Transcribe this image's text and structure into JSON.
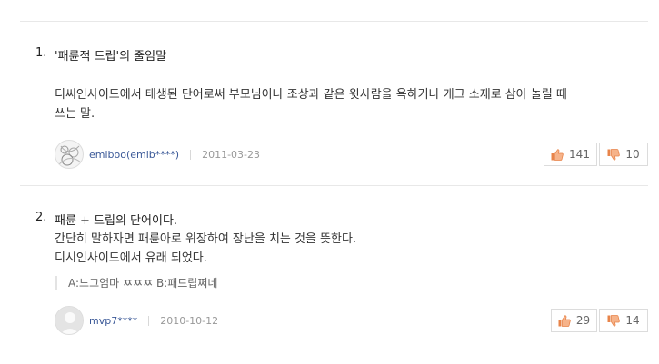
{
  "entries": [
    {
      "number": "1.",
      "title": "'패륜적 드립'의 줄임말",
      "body_lines": [
        "디씨인사이드에서 태생된 단어로써 부모님이나 조상과 같은 윗사람을 욕하거나 개그 소재로 삼아 놀릴 때",
        "쓰는 말."
      ],
      "author": "emiboo(emib****)",
      "date": "2011-03-23",
      "likes": "141",
      "dislikes": "10"
    },
    {
      "number": "2.",
      "title": "패륜 + 드립의 단어이다.",
      "body_lines": [
        "간단히 말하자면 패륜아로 위장하여 장난을 치는 것을 뜻한다.",
        "디시인사이드에서 유래 되었다."
      ],
      "quote": "A:느그엄마 ㅉㅉㅉ B:패드립쩌네",
      "author": "mvp7****",
      "date": "2010-10-12",
      "likes": "29",
      "dislikes": "14"
    }
  ],
  "colors": {
    "author": "#3b5998",
    "like_icon": "#e8844a",
    "dislike_icon": "#e8844a",
    "divider": "#e8e8e8"
  },
  "icons": {
    "like": "thumbs-up-icon",
    "dislike": "thumbs-down-icon"
  }
}
